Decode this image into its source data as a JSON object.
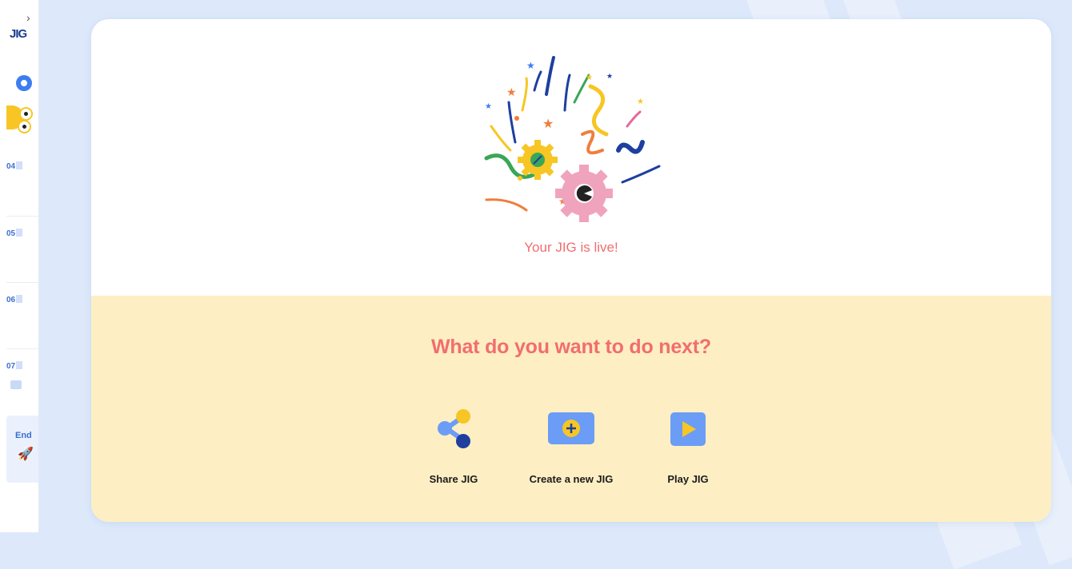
{
  "sidebar": {
    "toggle_glyph": "›",
    "logo": "JIG",
    "slides": [
      {
        "number": "04"
      },
      {
        "number": "05"
      },
      {
        "number": "06"
      },
      {
        "number": "07"
      }
    ],
    "end_label": "End"
  },
  "main": {
    "status_message": "Your JIG is live!",
    "next_heading": "What do you want to do next?",
    "actions": [
      {
        "label": "Share JIG",
        "icon": "share-icon"
      },
      {
        "label": "Create a new JIG",
        "icon": "plus-icon"
      },
      {
        "label": "Play JIG",
        "icon": "play-icon"
      }
    ]
  },
  "colors": {
    "background": "#dde9fb",
    "accent_coral": "#f26d6f",
    "bottom_panel": "#fdefc3",
    "action_blue": "#6b9cf6",
    "action_yellow": "#f7c624",
    "navy": "#1a3d8f"
  }
}
